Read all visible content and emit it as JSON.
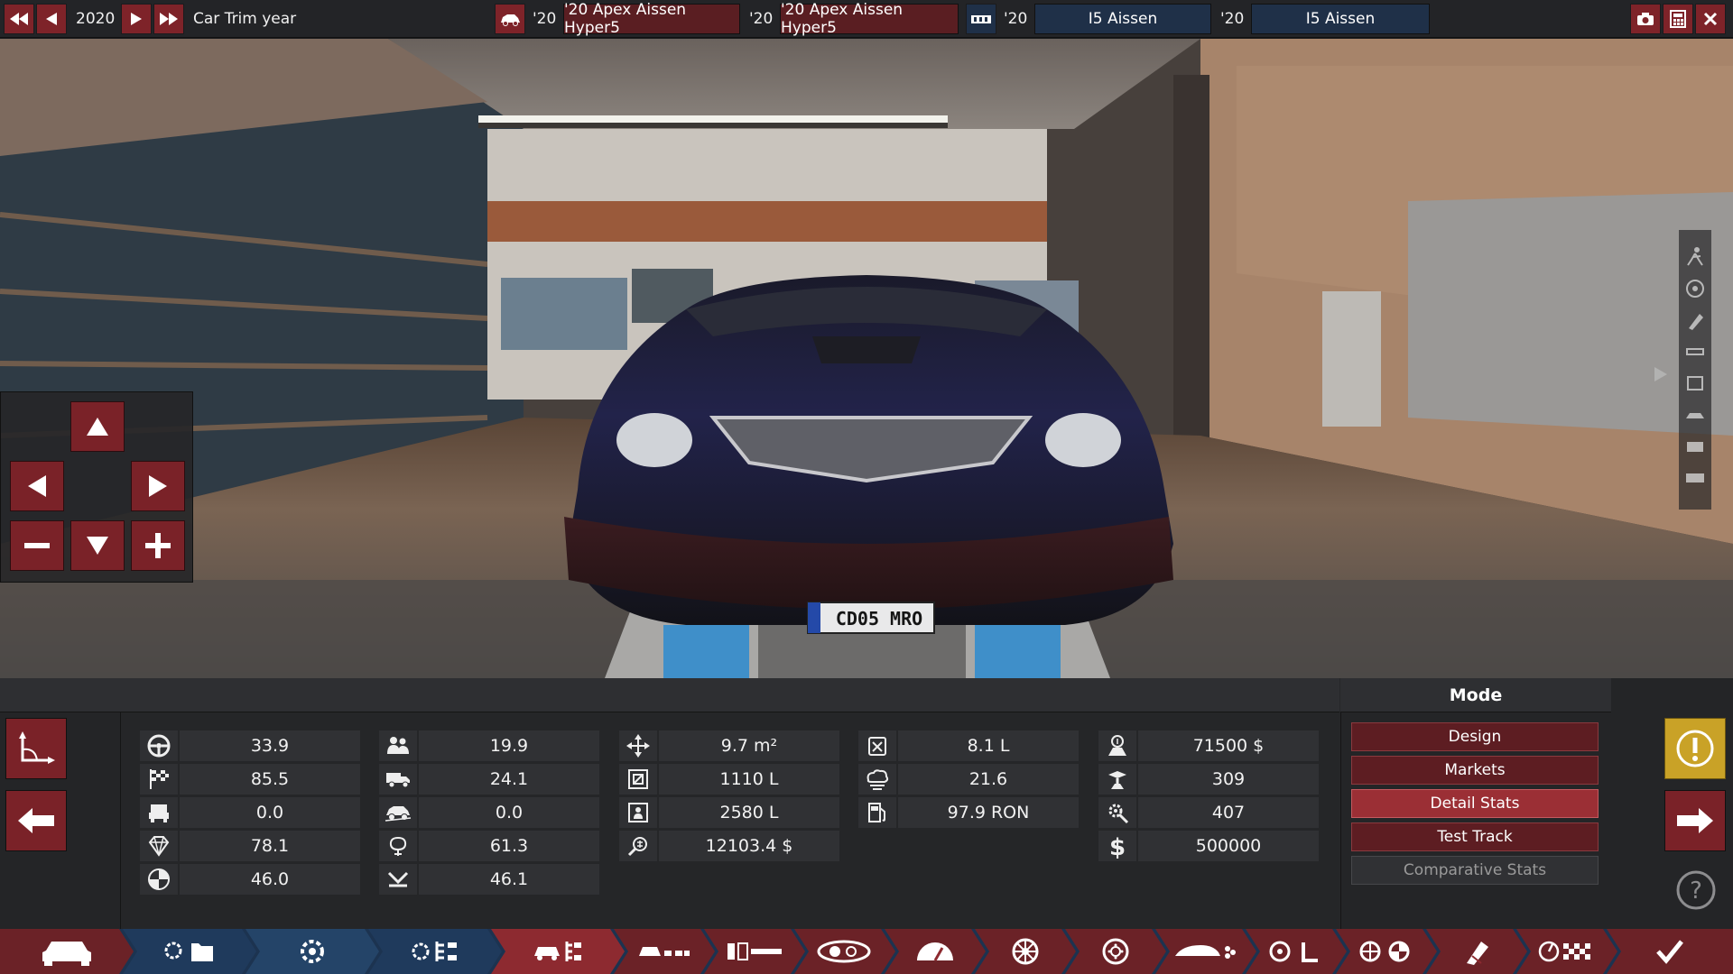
{
  "topbar": {
    "year": "2020",
    "trim_year_label": "Car Trim year",
    "model_year": "'20",
    "model_name": "'20 Apex Aissen Hyper5",
    "trim_year": "'20",
    "trim_name": "'20 Apex Aissen Hyper5",
    "engine_year": "'20",
    "engine_family": "I5 Aissen",
    "engine_var_year": "'20",
    "engine_variant": "I5 Aissen"
  },
  "scene": {
    "license_plate": "CD05 MRO"
  },
  "stats": {
    "col1": [
      {
        "icon": "steering-wheel-icon",
        "value": "33.9"
      },
      {
        "icon": "checkered-flag-icon",
        "value": "85.5"
      },
      {
        "icon": "seat-icon",
        "value": "0.0"
      },
      {
        "icon": "diamond-icon",
        "value": "78.1"
      },
      {
        "icon": "safety-icon",
        "value": "46.0"
      }
    ],
    "col2": [
      {
        "icon": "passengers-icon",
        "value": "19.9"
      },
      {
        "icon": "cargo-truck-icon",
        "value": "24.1"
      },
      {
        "icon": "offroad-car-icon",
        "value": "0.0"
      },
      {
        "icon": "environment-icon",
        "value": "61.3"
      },
      {
        "icon": "reliability-icon",
        "value": "46.1"
      }
    ],
    "col3": [
      {
        "icon": "frontal-area-icon",
        "value": "9.7 m²"
      },
      {
        "icon": "cargo-volume-icon",
        "value": "1110 L"
      },
      {
        "icon": "passenger-volume-icon",
        "value": "2580 L"
      },
      {
        "icon": "service-cost-icon",
        "value": "12103.4 $"
      }
    ],
    "col4": [
      {
        "icon": "fuel-tank-icon",
        "value": "8.1 L"
      },
      {
        "icon": "emissions-icon",
        "value": "21.6"
      },
      {
        "icon": "fuel-pump-icon",
        "value": "97.9 RON"
      }
    ],
    "col5": [
      {
        "icon": "production-cost-icon",
        "value": "71500 $"
      },
      {
        "icon": "man-hours-icon",
        "value": "309"
      },
      {
        "icon": "engineering-icon",
        "value": "407"
      },
      {
        "icon": "dollar-icon",
        "value": "500000"
      }
    ]
  },
  "mode": {
    "title": "Mode",
    "buttons": [
      {
        "label": "Design",
        "state": "normal"
      },
      {
        "label": "Markets",
        "state": "normal"
      },
      {
        "label": "Detail Stats",
        "state": "active"
      },
      {
        "label": "Test Track",
        "state": "normal"
      },
      {
        "label": "Comparative Stats",
        "state": "disabled"
      }
    ]
  },
  "colors": {
    "accent_red": "#8d2a30",
    "tab_blue": "#1f3a5c",
    "warning_yellow": "#c9a227"
  }
}
